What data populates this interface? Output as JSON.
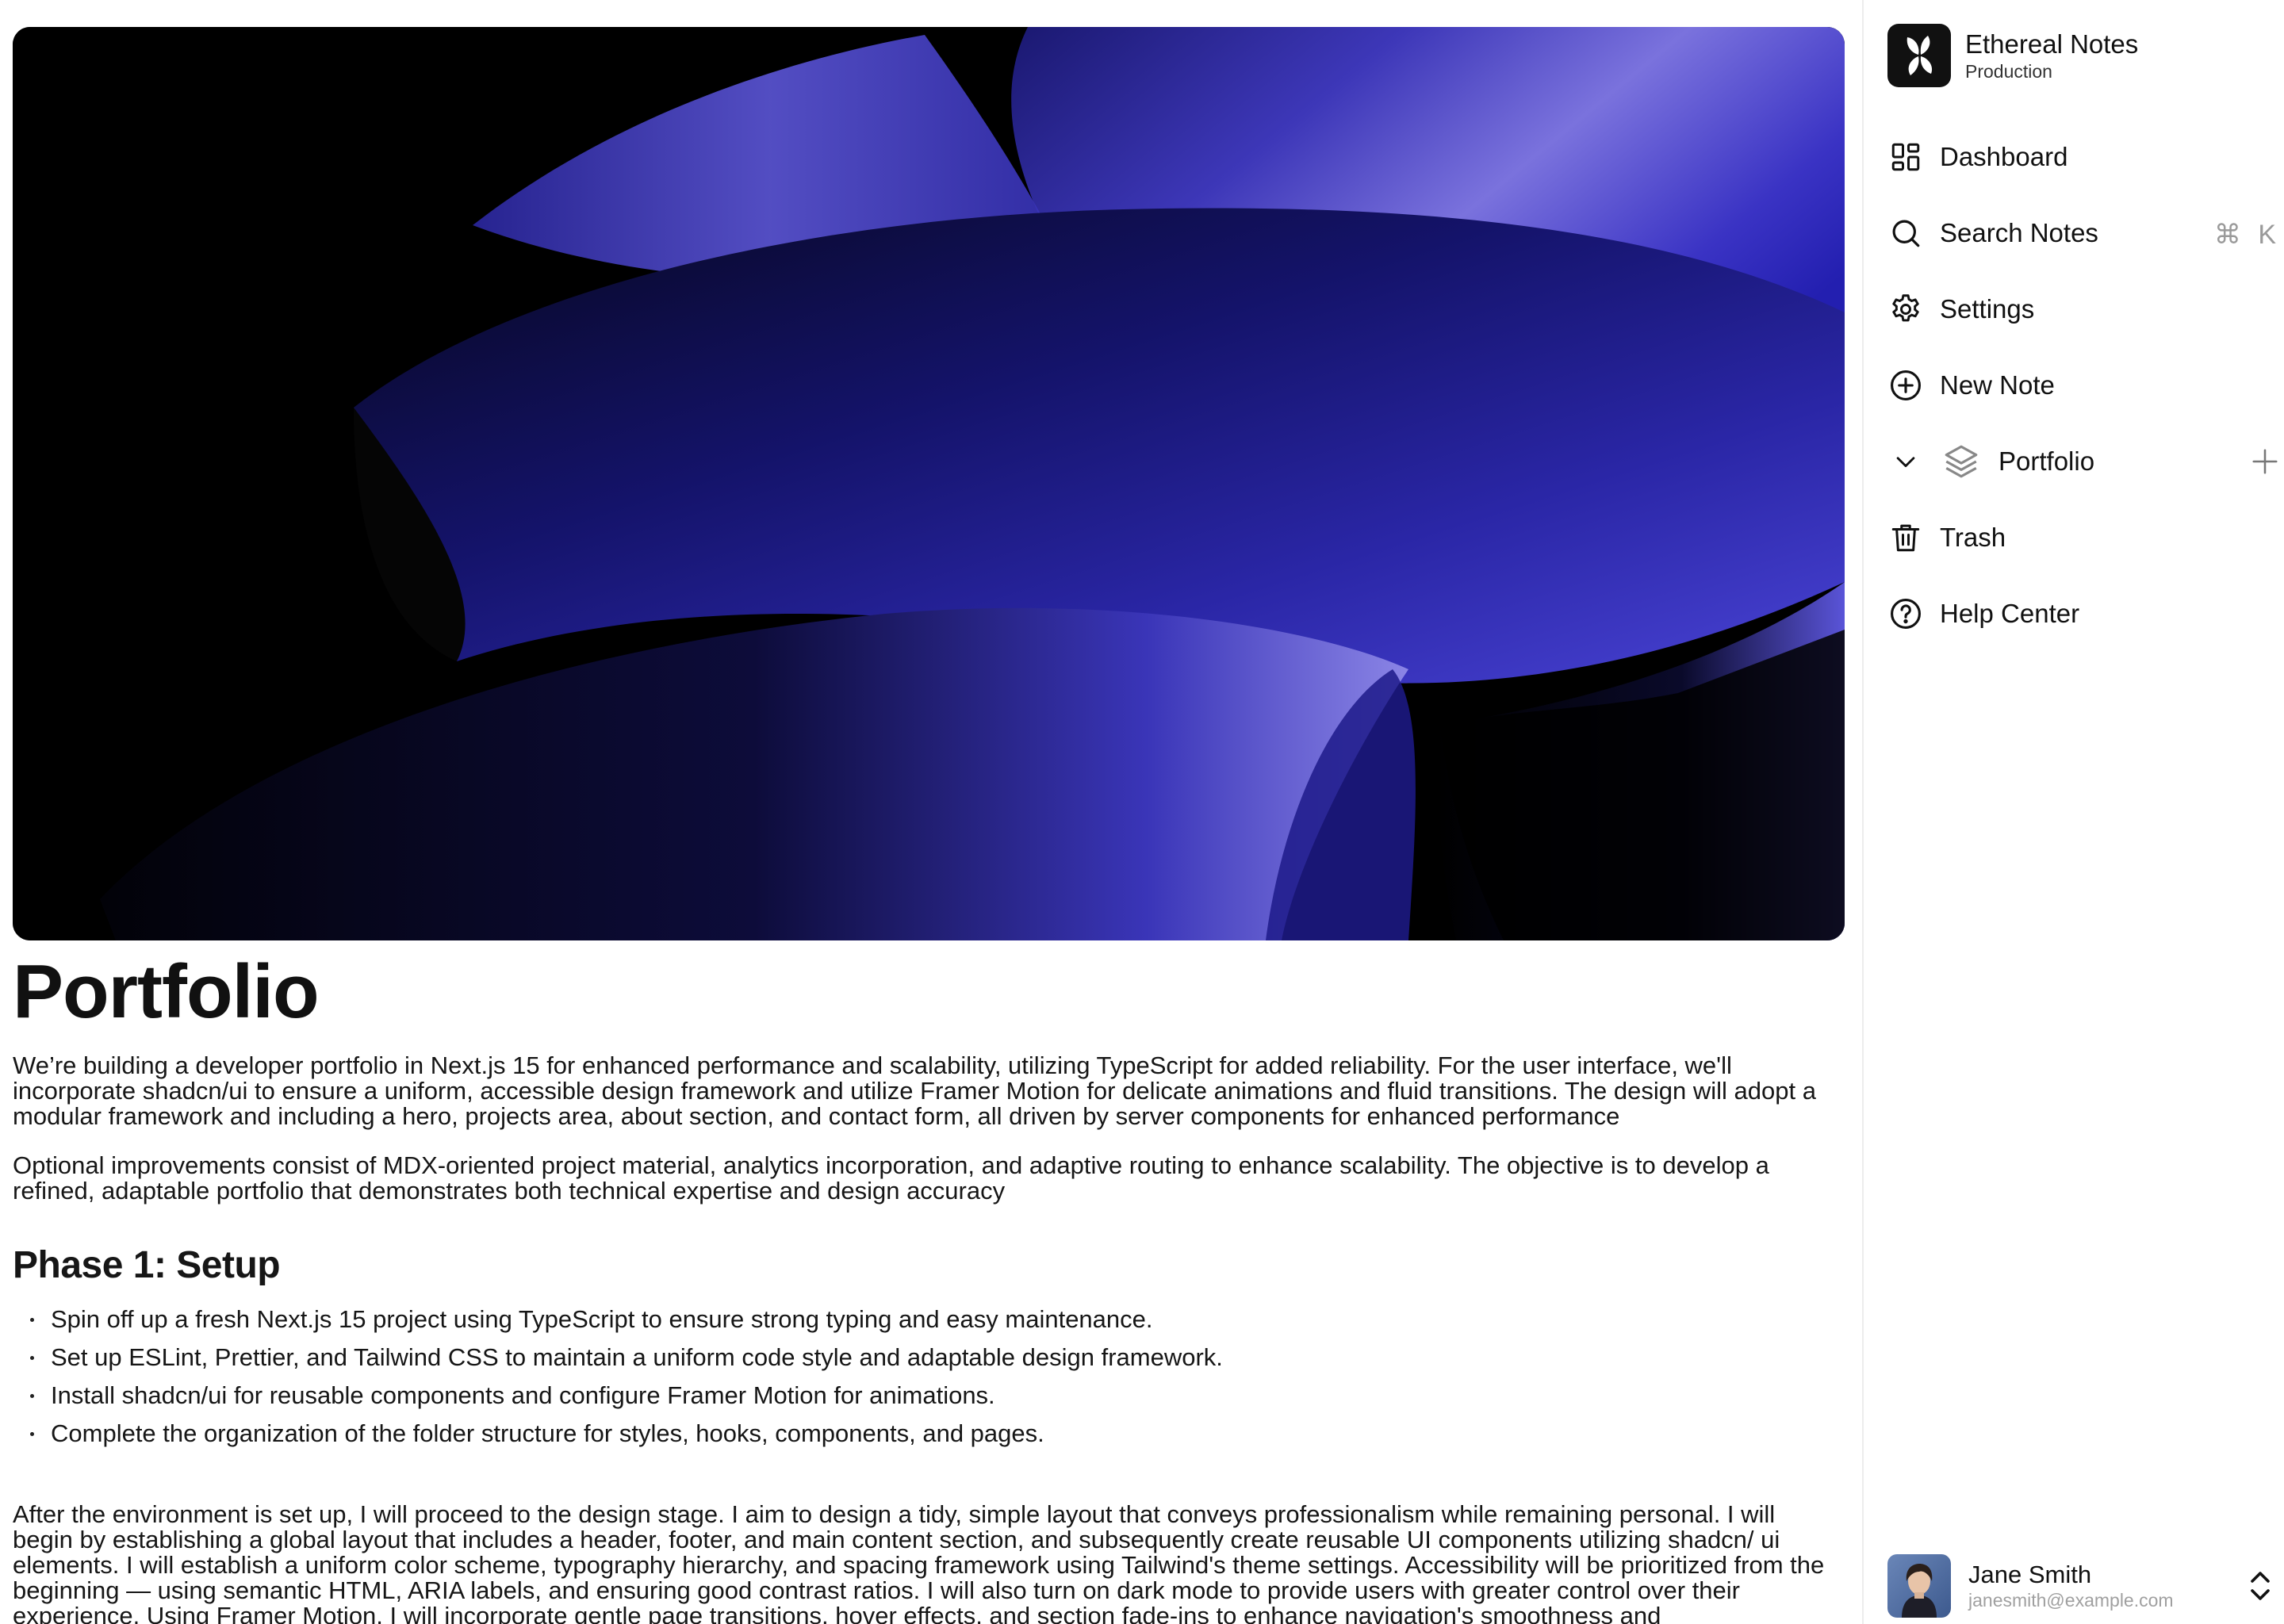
{
  "workspace": {
    "name": "Ethereal Notes",
    "environment": "Production"
  },
  "nav": {
    "dashboard": "Dashboard",
    "search": "Search Notes",
    "search_shortcut": "⌘ K",
    "settings": "Settings",
    "new_note": "New Note",
    "portfolio": "Portfolio",
    "trash": "Trash",
    "help": "Help Center"
  },
  "user": {
    "name": "Jane Smith",
    "email": "janesmith@example.com"
  },
  "document": {
    "title": "Portfolio",
    "paragraphs": [
      "We’re building a developer portfolio in Next.js 15 for enhanced performance and scalability, utilizing TypeScript for added reliability. For the user interface, we'll incorporate shadcn/ui to ensure a uniform, accessible design framework and utilize Framer Motion for delicate animations and fluid transitions. The design will adopt a modular framework and including a hero, projects area, about section, and contact form, all driven by server components for enhanced performance",
      "Optional improvements consist of MDX-oriented project material, analytics incorporation, and adaptive routing to enhance scalability. The objective is to develop a refined, adaptable portfolio that demonstrates both technical expertise and design accuracy"
    ],
    "phase1": {
      "heading": "Phase 1: Setup",
      "items": [
        "Spin off up a fresh Next.js 15 project using TypeScript to ensure strong typing and easy maintenance.",
        "Set up ESLint, Prettier, and Tailwind CSS to maintain a uniform code style and adaptable design framework.",
        "Install shadcn/ui for reusable components and configure Framer Motion for animations.",
        "Complete the organization of the folder structure for styles, hooks, components, and pages."
      ]
    },
    "after_paragraph": "After the environment is set up, I will proceed to the design stage. I aim to design a tidy, simple layout that conveys professionalism while remaining personal. I will begin by establishing a global layout that includes a header, footer, and main content section, and subsequently create reusable UI components utilizing shadcn/ ui elements. I will establish a uniform color scheme, typography hierarchy, and spacing framework using Tailwind's theme settings. Accessibility will be prioritized from the beginning — using semantic HTML, ARIA labels, and ensuring good contrast ratios. I will also turn on dark mode to provide users with greater control over their experience. Using Framer Motion, I will incorporate gentle page transitions, hover effects, and section fade-ins to enhance navigation's smoothness and"
  },
  "colors": {
    "accent": "#4a44d6",
    "cover_bg": "#000000",
    "text": "#111111",
    "muted": "#a0a0a0"
  }
}
